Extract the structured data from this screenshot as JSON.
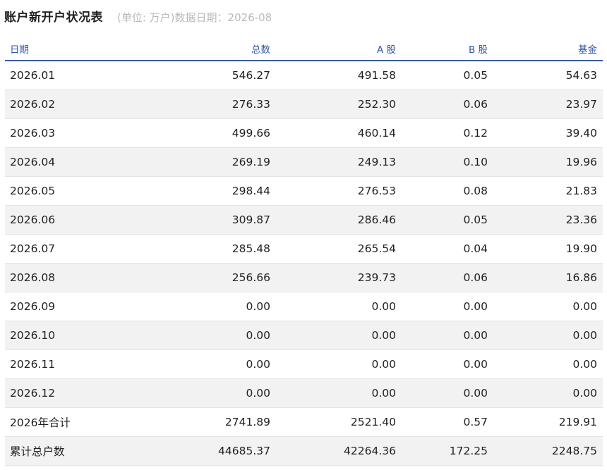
{
  "header": {
    "title": "账户新开户状况表",
    "subtitle": "(单位: 万户)数据日期：2026-08"
  },
  "table": {
    "columns": [
      "日期",
      "总数",
      "A 股",
      "B 股",
      "基金"
    ],
    "rows": [
      [
        "2026.01",
        "546.27",
        "491.58",
        "0.05",
        "54.63"
      ],
      [
        "2026.02",
        "276.33",
        "252.30",
        "0.06",
        "23.97"
      ],
      [
        "2026.03",
        "499.66",
        "460.14",
        "0.12",
        "39.40"
      ],
      [
        "2026.04",
        "269.19",
        "249.13",
        "0.10",
        "19.96"
      ],
      [
        "2026.05",
        "298.44",
        "276.53",
        "0.08",
        "21.83"
      ],
      [
        "2026.06",
        "309.87",
        "286.46",
        "0.05",
        "23.36"
      ],
      [
        "2026.07",
        "285.48",
        "265.54",
        "0.04",
        "19.90"
      ],
      [
        "2026.08",
        "256.66",
        "239.73",
        "0.06",
        "16.86"
      ],
      [
        "2026.09",
        "0.00",
        "0.00",
        "0.00",
        "0.00"
      ],
      [
        "2026.10",
        "0.00",
        "0.00",
        "0.00",
        "0.00"
      ],
      [
        "2026.11",
        "0.00",
        "0.00",
        "0.00",
        "0.00"
      ],
      [
        "2026.12",
        "0.00",
        "0.00",
        "0.00",
        "0.00"
      ],
      [
        "2026年合计",
        "2741.89",
        "2521.40",
        "0.57",
        "219.91"
      ],
      [
        "累计总户数",
        "44685.37",
        "42264.36",
        "172.25",
        "2248.75"
      ]
    ]
  },
  "colors": {
    "header_text": "#2f54a8",
    "header_rule": "#3a5aa0",
    "stripe": "#f2f2f2",
    "subtitle": "#b9b9b9"
  }
}
